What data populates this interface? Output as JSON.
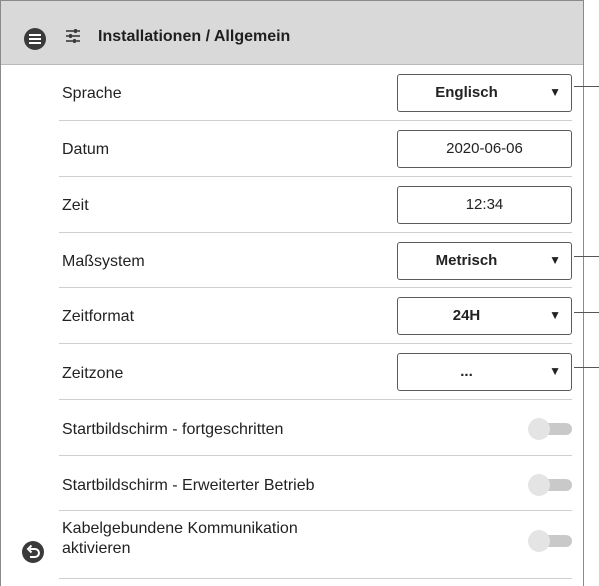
{
  "header": {
    "title": "Installationen / Allgemein",
    "menu_icon": "hamburger-icon",
    "settings_icon": "sliders-icon"
  },
  "rows": {
    "language": {
      "label": "Sprache",
      "value": "Englisch",
      "caret": "▼"
    },
    "date": {
      "label": "Datum",
      "value": "2020-06-06"
    },
    "time": {
      "label": "Zeit",
      "value": "12:34"
    },
    "measure": {
      "label": "Maßsystem",
      "value": "Metrisch",
      "caret": "▼"
    },
    "timeformat": {
      "label": "Zeitformat",
      "value": "24H",
      "caret": "▼"
    },
    "timezone": {
      "label": "Zeitzone",
      "value": "...",
      "caret": "▼"
    },
    "start_advanced": {
      "label": "Startbildschirm - fortgeschritten",
      "on": false
    },
    "start_extended": {
      "label": "Startbildschirm - Erweiterter Betrieb",
      "on": false
    },
    "wired_comm": {
      "label_line1": "Kabelgebundene Kommunikation",
      "label_line2": "aktivieren",
      "on": false
    }
  },
  "footer": {
    "back_icon": "back-icon"
  },
  "colors": {
    "header_bg": "#d9d9d9",
    "toggle_off": "#c9c9c9",
    "icon_dark": "#3a3a3a"
  }
}
